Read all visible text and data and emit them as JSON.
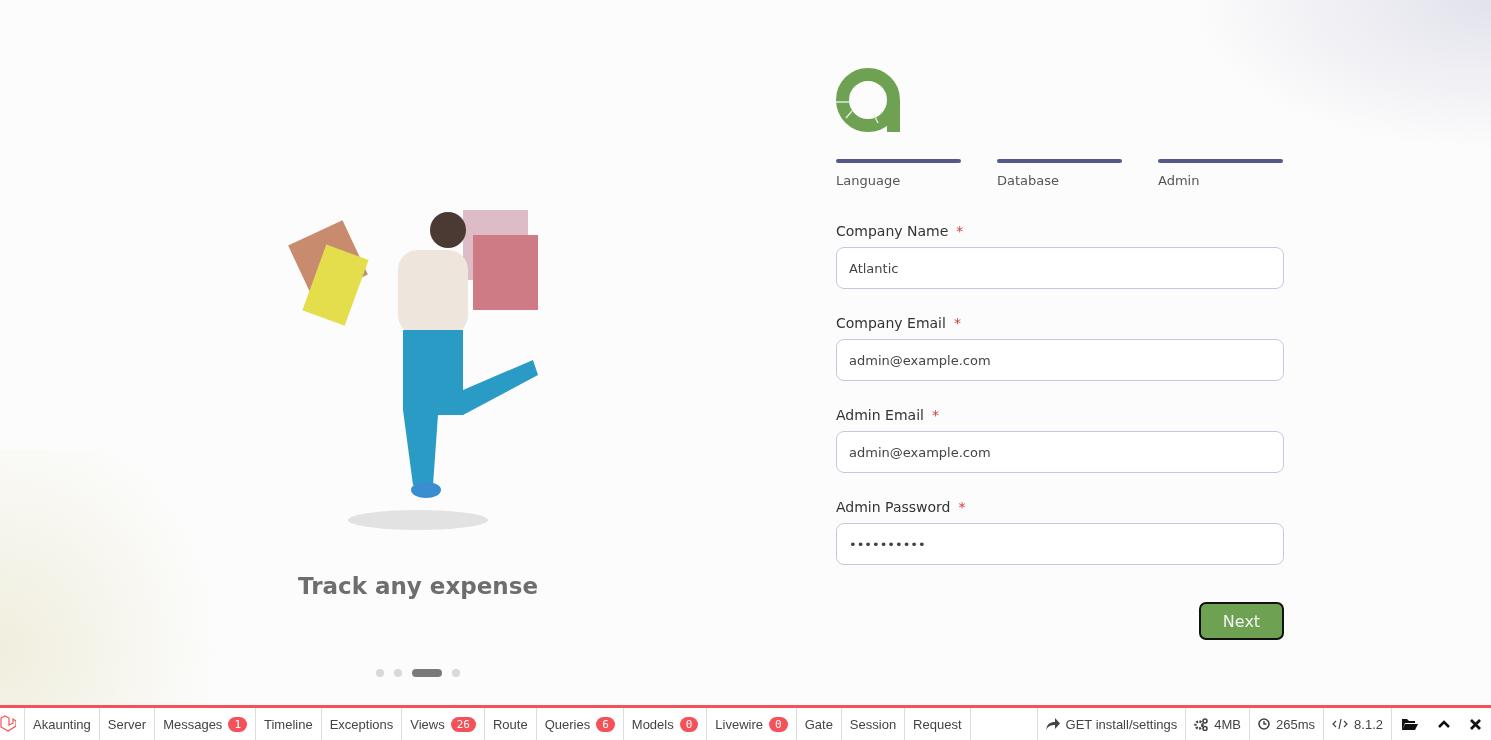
{
  "slide": {
    "caption": "Track any expense",
    "dots": [
      {
        "selected": false
      },
      {
        "selected": false
      },
      {
        "selected": true
      },
      {
        "selected": false
      }
    ]
  },
  "steps": [
    {
      "label": "Language",
      "done": true
    },
    {
      "label": "Database",
      "done": true
    },
    {
      "label": "Admin",
      "done": true
    }
  ],
  "fields": [
    {
      "label": "Company Name",
      "required": "*",
      "value": "Atlantic"
    },
    {
      "label": "Company Email",
      "required": "*",
      "value": "admin@example.com"
    },
    {
      "label": "Admin Email",
      "required": "*",
      "value": "admin@example.com"
    },
    {
      "label": "Admin Password",
      "required": "*",
      "value": "••••••••••"
    }
  ],
  "next_button": "Next",
  "debugbar": {
    "tabs": [
      {
        "label": "Akaunting"
      },
      {
        "label": "Server"
      },
      {
        "label": "Messages",
        "badge": "1"
      },
      {
        "label": "Timeline"
      },
      {
        "label": "Exceptions"
      },
      {
        "label": "Views",
        "badge": "26"
      },
      {
        "label": "Route"
      },
      {
        "label": "Queries",
        "badge": "6"
      },
      {
        "label": "Models",
        "badge": "0"
      },
      {
        "label": "Livewire",
        "badge": "0"
      },
      {
        "label": "Gate"
      },
      {
        "label": "Session"
      },
      {
        "label": "Request"
      }
    ],
    "status": [
      {
        "kind": "request",
        "text": "GET install/settings"
      },
      {
        "kind": "memory",
        "text": "4MB"
      },
      {
        "kind": "time",
        "text": "265ms"
      },
      {
        "kind": "php",
        "text": "8.1.2"
      }
    ]
  }
}
